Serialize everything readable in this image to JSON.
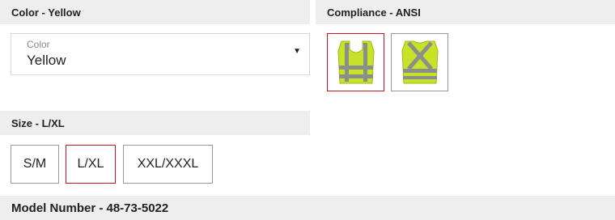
{
  "color_section": {
    "header": "Color - Yellow",
    "select_label": "Color",
    "select_value": "Yellow"
  },
  "compliance_section": {
    "header": "Compliance - ANSI",
    "options": [
      {
        "icon": "safety-vest-front-icon",
        "selected": true
      },
      {
        "icon": "safety-vest-back-x-icon",
        "selected": false
      }
    ]
  },
  "size_section": {
    "header": "Size - L/XL",
    "options": [
      {
        "label": "S/M",
        "selected": false
      },
      {
        "label": "L/XL",
        "selected": true
      },
      {
        "label": "XXL/XXXL",
        "selected": false
      }
    ]
  },
  "model_section": {
    "header": "Model Number - 48-73-5022"
  },
  "colors": {
    "vest": "#c8e227",
    "stripe": "#8a8f8a",
    "selected_border": "#c4161c",
    "header_bg": "#eeeeee"
  }
}
